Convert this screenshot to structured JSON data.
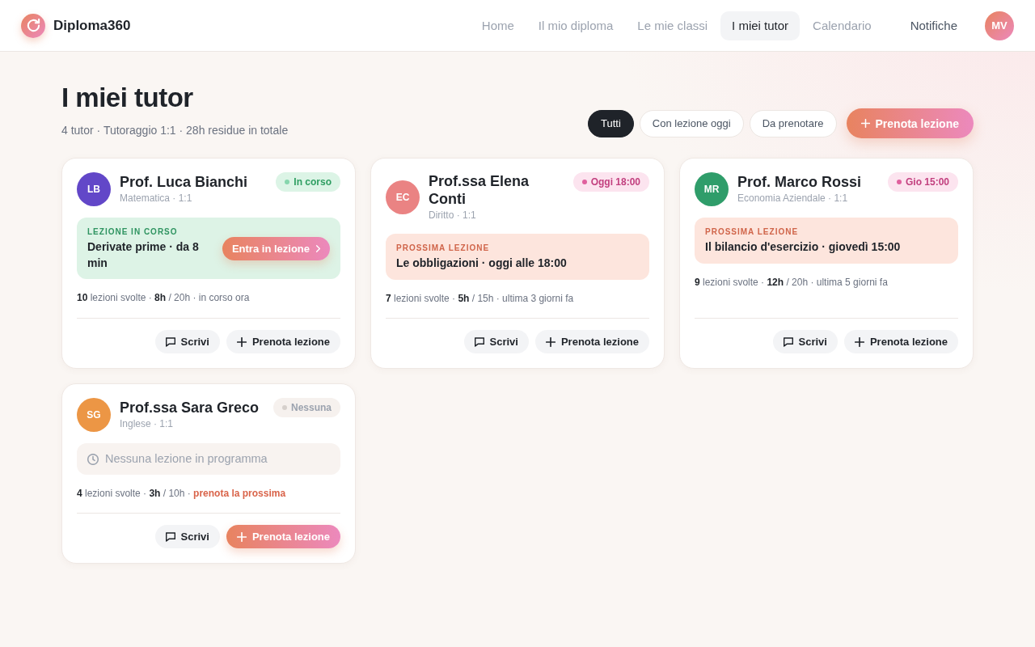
{
  "app": {
    "name": "Diploma360"
  },
  "nav": {
    "items": [
      {
        "label": "Home",
        "selected": false
      },
      {
        "label": "Il mio diploma",
        "selected": false
      },
      {
        "label": "Le mie classi",
        "selected": false
      },
      {
        "label": "I miei tutor",
        "selected": true
      },
      {
        "label": "Calendario",
        "selected": false
      }
    ],
    "notifications": "Notifiche",
    "user_initials": "MV"
  },
  "page": {
    "title": "I miei tutor",
    "subtitle": "4 tutor · Tutoraggio 1:1 · 28h residue in totale"
  },
  "filters": [
    {
      "label": "Tutti",
      "selected": true
    },
    {
      "label": "Con lezione oggi",
      "selected": false
    },
    {
      "label": "Da prenotare",
      "selected": false
    }
  ],
  "primary_action": {
    "label": "Prenota lezione"
  },
  "tutors": [
    {
      "initials": "LB",
      "color": "#6247c8",
      "name": "Prof. Luca Bianchi",
      "subject": "Matematica · 1:1",
      "badge": {
        "kind": "live",
        "label": "In corso"
      },
      "lesson": {
        "kind": "live",
        "label": "LEZIONE IN CORSO",
        "text": "Derivate prime · da 8 min",
        "action": "Entra in lezione"
      },
      "stats": "**10** lezioni svolte · **8h** / 20h · in corso ora",
      "actions": [
        {
          "kind": "message",
          "label": "Scrivi",
          "primary": false
        },
        {
          "kind": "book",
          "label": "Prenota lezione",
          "primary": false
        }
      ]
    },
    {
      "initials": "EC",
      "color": "#ea8383",
      "name": "Prof.ssa Elena Conti",
      "subject": "Diritto · 1:1",
      "badge": {
        "kind": "scheduled",
        "label": "Oggi 18:00"
      },
      "lesson": {
        "kind": "next",
        "label": "PROSSIMA LEZIONE",
        "text": "Le obbligazioni · oggi alle 18:00"
      },
      "stats": "**7** lezioni svolte · **5h** / 15h · ultima 3 giorni fa",
      "actions": [
        {
          "kind": "message",
          "label": "Scrivi",
          "primary": false
        },
        {
          "kind": "book",
          "label": "Prenota lezione",
          "primary": false
        }
      ]
    },
    {
      "initials": "MR",
      "color": "#2f9d6a",
      "name": "Prof. Marco Rossi",
      "subject": "Economia Aziendale · 1:1",
      "badge": {
        "kind": "scheduled",
        "label": "Gio 15:00"
      },
      "lesson": {
        "kind": "next",
        "label": "PROSSIMA LEZIONE",
        "text": "Il bilancio d'esercizio · giovedì 15:00"
      },
      "stats": "**9** lezioni svolte · **12h** / 20h · ultima 5 giorni fa",
      "actions": [
        {
          "kind": "message",
          "label": "Scrivi",
          "primary": false
        },
        {
          "kind": "book",
          "label": "Prenota lezione",
          "primary": false
        }
      ]
    },
    {
      "initials": "SG",
      "color": "#ec9645",
      "name": "Prof.ssa Sara Greco",
      "subject": "Inglese · 1:1",
      "badge": {
        "kind": "none",
        "label": "Nessuna"
      },
      "lesson": {
        "kind": "empty",
        "text": "Nessuna lezione in programma"
      },
      "stats": "**4** lezioni svolte · **3h** / 10h ·",
      "stats_link": "prenota la prossima",
      "actions": [
        {
          "kind": "message",
          "label": "Scrivi",
          "primary": false
        },
        {
          "kind": "book",
          "label": "Prenota lezione",
          "primary": true
        }
      ]
    }
  ]
}
